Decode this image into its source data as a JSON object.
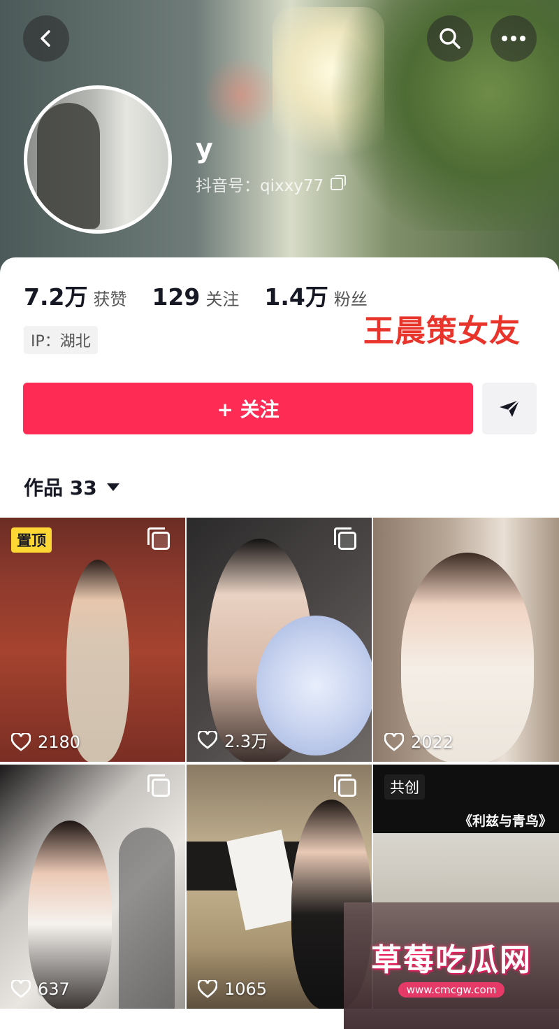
{
  "header": {
    "back_icon": "chevron-left-icon",
    "search_icon": "search-icon",
    "more_icon": "more-dots-icon"
  },
  "profile": {
    "username": "y",
    "douyin_id": "抖音号：qixxy77",
    "stats": [
      {
        "value": "7.2万",
        "label": "获赞"
      },
      {
        "value": "129",
        "label": "关注"
      },
      {
        "value": "1.4万",
        "label": "粉丝"
      }
    ],
    "ip": "IP：湖北",
    "overlay_caption": "王晨策女友"
  },
  "actions": {
    "follow_label": "+ 关注",
    "share_icon": "send-icon"
  },
  "works": {
    "tab_label": "作品 33"
  },
  "videos": [
    {
      "likes": "2180",
      "badge": "置顶",
      "multi": true
    },
    {
      "likes": "2.3万",
      "multi": true
    },
    {
      "likes": "2022",
      "multi": false
    },
    {
      "likes": "637",
      "multi": true
    },
    {
      "likes": "1065",
      "multi": true
    },
    {
      "likes": "",
      "badge": "共创",
      "tag": "《利兹与青鸟》",
      "multi": false
    }
  ],
  "watermark": {
    "title": "草莓吃瓜网",
    "url": "www.cmcgw.com"
  },
  "colors": {
    "follow_button": "#fe2c55",
    "pin_badge": "#fdd835",
    "overlay_caption": "#e8342a"
  }
}
